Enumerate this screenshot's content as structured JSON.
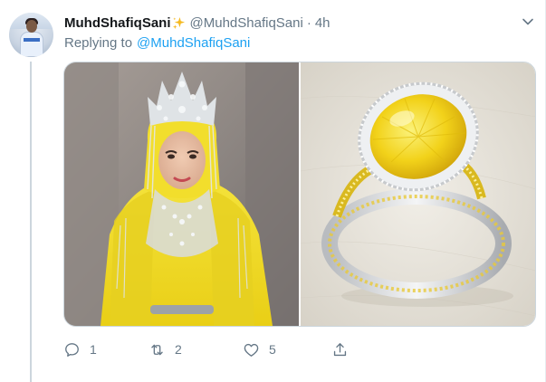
{
  "tweet": {
    "display_name": "MuhdShafiqSani",
    "display_emoji": "sparkles-icon",
    "handle": "@MuhdShafiqSani",
    "separator": "·",
    "time": "4h",
    "replying_prefix": "Replying to",
    "replying_to": "@MuhdShafiqSani"
  },
  "media": {
    "left_image": "bride-yellow-headdress-photo",
    "right_image": "yellow-diamond-ring-photo"
  },
  "actions": {
    "reply_count": "1",
    "retweet_count": "2",
    "like_count": "5"
  },
  "colors": {
    "link": "#1da1f2",
    "secondary_text": "#657786",
    "border": "#ccd6dd",
    "gold": "#f2d21a"
  },
  "icons": [
    "sparkles-icon",
    "chevron-down-icon",
    "reply-icon",
    "retweet-icon",
    "heart-icon",
    "share-icon"
  ]
}
